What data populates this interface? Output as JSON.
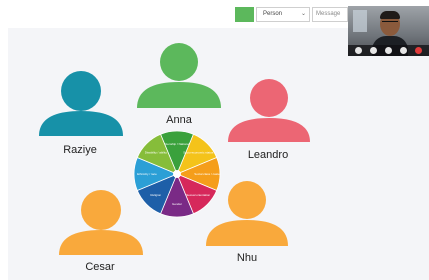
{
  "toolbar": {
    "color_hex": "#5cb85c",
    "select_value": "Person",
    "message_placeholder": "Message"
  },
  "people": [
    {
      "name": "Anna",
      "color": "#5cb85c"
    },
    {
      "name": "Raziye",
      "color": "#1791a8"
    },
    {
      "name": "Leandro",
      "color": "#ec6674"
    },
    {
      "name": "Cesar",
      "color": "#f9a93c"
    },
    {
      "name": "Nhu",
      "color": "#f9a93c"
    }
  ],
  "wheel": {
    "segments": [
      {
        "label": "Citizenship / Nationality",
        "color": "#3aa13c"
      },
      {
        "label": "Socio-economic status",
        "color": "#f4c31a"
      },
      {
        "label": "Social class / caste",
        "color": "#f59e1b"
      },
      {
        "label": "Sexual orientation",
        "color": "#d6285b"
      },
      {
        "label": "Gender",
        "color": "#7a2a86"
      },
      {
        "label": "Religion",
        "color": "#1e5fa8"
      },
      {
        "label": "Ethnicity / race",
        "color": "#2b9fd6"
      },
      {
        "label": "Disability / ability",
        "color": "#86bd3a"
      }
    ]
  },
  "video": {
    "icons": [
      "camera-icon",
      "mic-icon",
      "screen-share-icon",
      "more-icon",
      "hang-up-icon"
    ]
  }
}
